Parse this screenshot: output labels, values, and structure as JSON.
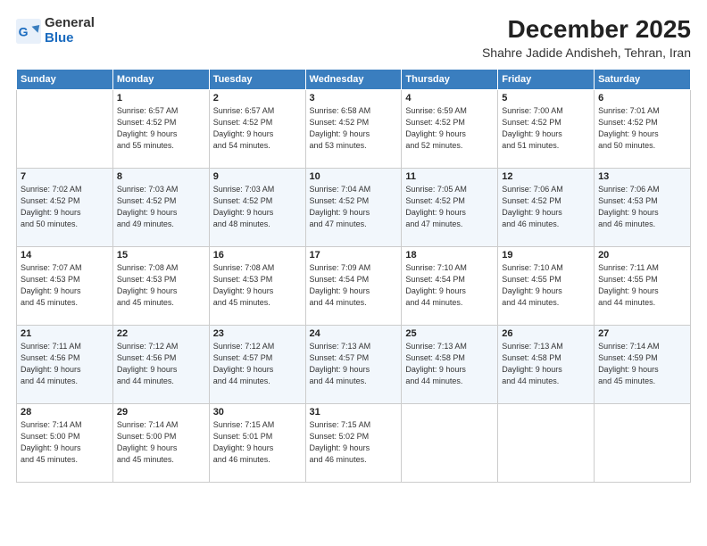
{
  "logo": {
    "general": "General",
    "blue": "Blue"
  },
  "header": {
    "month": "December 2025",
    "location": "Shahre Jadide Andisheh, Tehran, Iran"
  },
  "weekdays": [
    "Sunday",
    "Monday",
    "Tuesday",
    "Wednesday",
    "Thursday",
    "Friday",
    "Saturday"
  ],
  "weeks": [
    [
      {
        "day": "",
        "info": ""
      },
      {
        "day": "1",
        "info": "Sunrise: 6:57 AM\nSunset: 4:52 PM\nDaylight: 9 hours\nand 55 minutes."
      },
      {
        "day": "2",
        "info": "Sunrise: 6:57 AM\nSunset: 4:52 PM\nDaylight: 9 hours\nand 54 minutes."
      },
      {
        "day": "3",
        "info": "Sunrise: 6:58 AM\nSunset: 4:52 PM\nDaylight: 9 hours\nand 53 minutes."
      },
      {
        "day": "4",
        "info": "Sunrise: 6:59 AM\nSunset: 4:52 PM\nDaylight: 9 hours\nand 52 minutes."
      },
      {
        "day": "5",
        "info": "Sunrise: 7:00 AM\nSunset: 4:52 PM\nDaylight: 9 hours\nand 51 minutes."
      },
      {
        "day": "6",
        "info": "Sunrise: 7:01 AM\nSunset: 4:52 PM\nDaylight: 9 hours\nand 50 minutes."
      }
    ],
    [
      {
        "day": "7",
        "info": "Sunrise: 7:02 AM\nSunset: 4:52 PM\nDaylight: 9 hours\nand 50 minutes."
      },
      {
        "day": "8",
        "info": "Sunrise: 7:03 AM\nSunset: 4:52 PM\nDaylight: 9 hours\nand 49 minutes."
      },
      {
        "day": "9",
        "info": "Sunrise: 7:03 AM\nSunset: 4:52 PM\nDaylight: 9 hours\nand 48 minutes."
      },
      {
        "day": "10",
        "info": "Sunrise: 7:04 AM\nSunset: 4:52 PM\nDaylight: 9 hours\nand 47 minutes."
      },
      {
        "day": "11",
        "info": "Sunrise: 7:05 AM\nSunset: 4:52 PM\nDaylight: 9 hours\nand 47 minutes."
      },
      {
        "day": "12",
        "info": "Sunrise: 7:06 AM\nSunset: 4:52 PM\nDaylight: 9 hours\nand 46 minutes."
      },
      {
        "day": "13",
        "info": "Sunrise: 7:06 AM\nSunset: 4:53 PM\nDaylight: 9 hours\nand 46 minutes."
      }
    ],
    [
      {
        "day": "14",
        "info": "Sunrise: 7:07 AM\nSunset: 4:53 PM\nDaylight: 9 hours\nand 45 minutes."
      },
      {
        "day": "15",
        "info": "Sunrise: 7:08 AM\nSunset: 4:53 PM\nDaylight: 9 hours\nand 45 minutes."
      },
      {
        "day": "16",
        "info": "Sunrise: 7:08 AM\nSunset: 4:53 PM\nDaylight: 9 hours\nand 45 minutes."
      },
      {
        "day": "17",
        "info": "Sunrise: 7:09 AM\nSunset: 4:54 PM\nDaylight: 9 hours\nand 44 minutes."
      },
      {
        "day": "18",
        "info": "Sunrise: 7:10 AM\nSunset: 4:54 PM\nDaylight: 9 hours\nand 44 minutes."
      },
      {
        "day": "19",
        "info": "Sunrise: 7:10 AM\nSunset: 4:55 PM\nDaylight: 9 hours\nand 44 minutes."
      },
      {
        "day": "20",
        "info": "Sunrise: 7:11 AM\nSunset: 4:55 PM\nDaylight: 9 hours\nand 44 minutes."
      }
    ],
    [
      {
        "day": "21",
        "info": "Sunrise: 7:11 AM\nSunset: 4:56 PM\nDaylight: 9 hours\nand 44 minutes."
      },
      {
        "day": "22",
        "info": "Sunrise: 7:12 AM\nSunset: 4:56 PM\nDaylight: 9 hours\nand 44 minutes."
      },
      {
        "day": "23",
        "info": "Sunrise: 7:12 AM\nSunset: 4:57 PM\nDaylight: 9 hours\nand 44 minutes."
      },
      {
        "day": "24",
        "info": "Sunrise: 7:13 AM\nSunset: 4:57 PM\nDaylight: 9 hours\nand 44 minutes."
      },
      {
        "day": "25",
        "info": "Sunrise: 7:13 AM\nSunset: 4:58 PM\nDaylight: 9 hours\nand 44 minutes."
      },
      {
        "day": "26",
        "info": "Sunrise: 7:13 AM\nSunset: 4:58 PM\nDaylight: 9 hours\nand 44 minutes."
      },
      {
        "day": "27",
        "info": "Sunrise: 7:14 AM\nSunset: 4:59 PM\nDaylight: 9 hours\nand 45 minutes."
      }
    ],
    [
      {
        "day": "28",
        "info": "Sunrise: 7:14 AM\nSunset: 5:00 PM\nDaylight: 9 hours\nand 45 minutes."
      },
      {
        "day": "29",
        "info": "Sunrise: 7:14 AM\nSunset: 5:00 PM\nDaylight: 9 hours\nand 45 minutes."
      },
      {
        "day": "30",
        "info": "Sunrise: 7:15 AM\nSunset: 5:01 PM\nDaylight: 9 hours\nand 46 minutes."
      },
      {
        "day": "31",
        "info": "Sunrise: 7:15 AM\nSunset: 5:02 PM\nDaylight: 9 hours\nand 46 minutes."
      },
      {
        "day": "",
        "info": ""
      },
      {
        "day": "",
        "info": ""
      },
      {
        "day": "",
        "info": ""
      }
    ]
  ]
}
